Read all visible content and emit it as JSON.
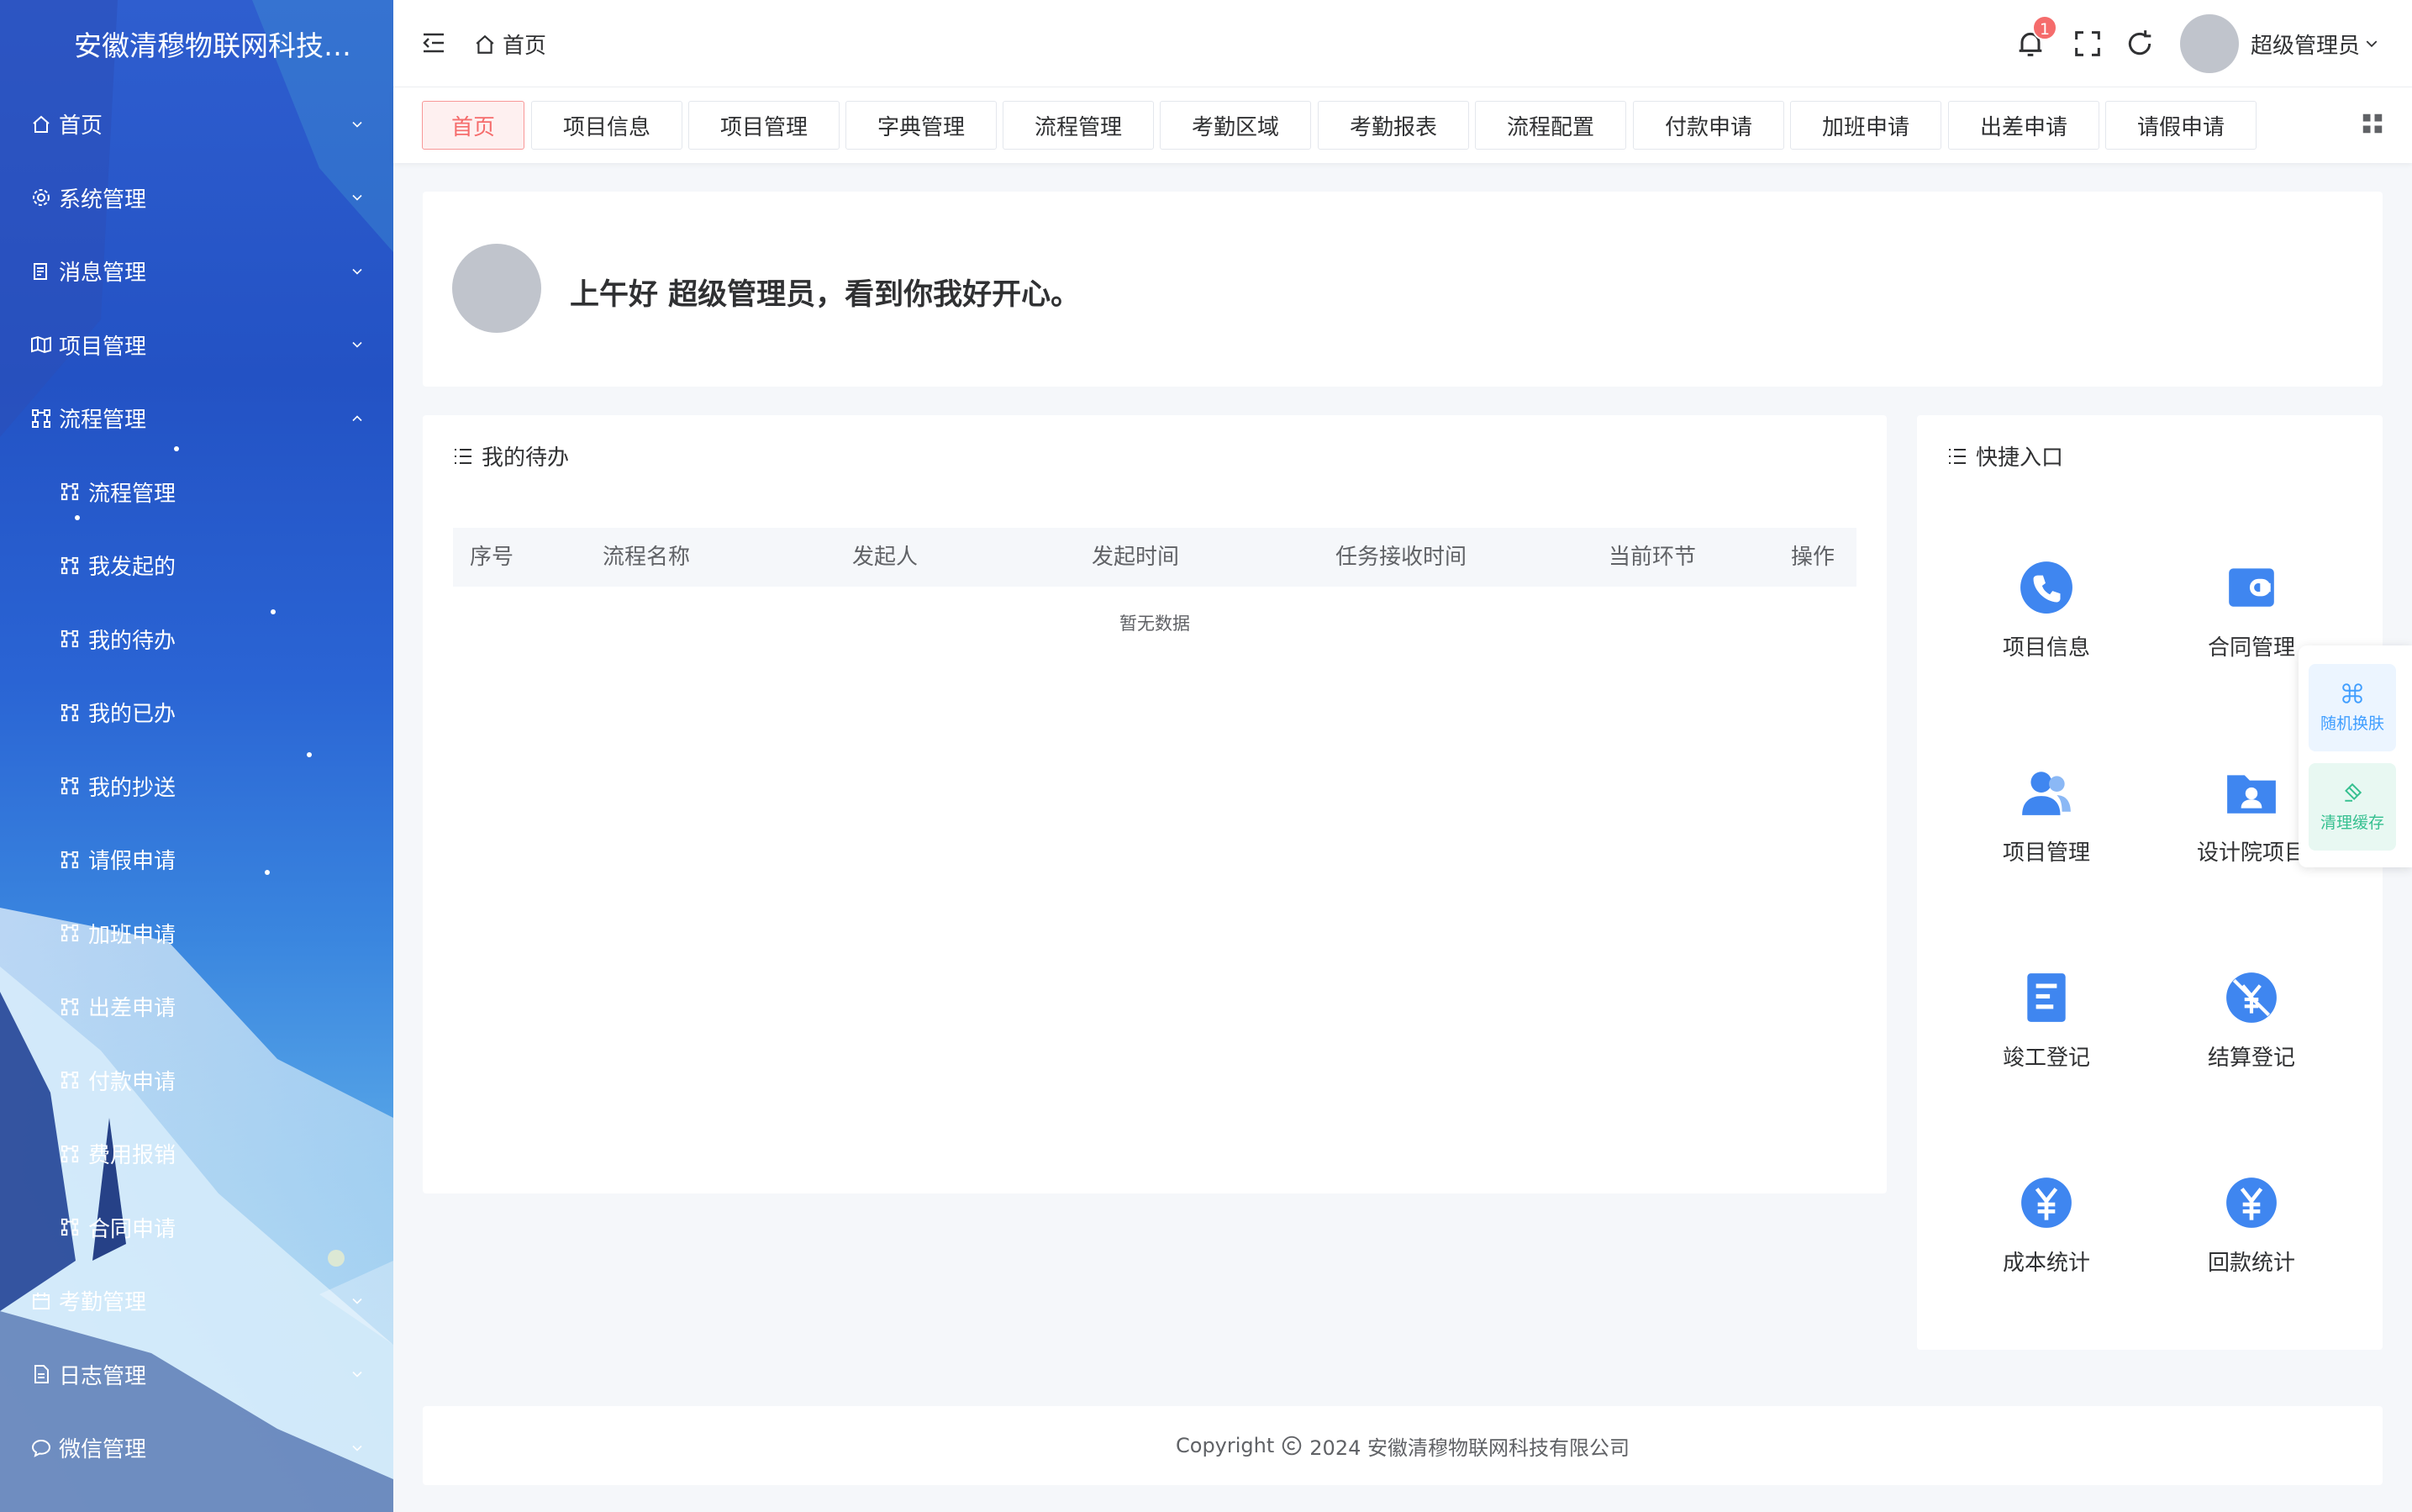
{
  "app": {
    "title": "安徽清穆物联网科技有..."
  },
  "sidebar": {
    "items": [
      {
        "label": "首页",
        "icon": "home-icon"
      },
      {
        "label": "系统管理",
        "icon": "gear-icon"
      },
      {
        "label": "消息管理",
        "icon": "document-icon"
      },
      {
        "label": "项目管理",
        "icon": "map-icon"
      },
      {
        "label": "流程管理",
        "icon": "flow-icon",
        "expanded": true
      },
      {
        "label": "流程管理",
        "icon": "flow-icon",
        "sub": true
      },
      {
        "label": "我发起的",
        "icon": "flow-icon",
        "sub": true
      },
      {
        "label": "我的待办",
        "icon": "flow-icon",
        "sub": true
      },
      {
        "label": "我的已办",
        "icon": "flow-icon",
        "sub": true
      },
      {
        "label": "我的抄送",
        "icon": "flow-icon",
        "sub": true
      },
      {
        "label": "请假申请",
        "icon": "flow-icon",
        "sub": true
      },
      {
        "label": "加班申请",
        "icon": "flow-icon",
        "sub": true
      },
      {
        "label": "出差申请",
        "icon": "flow-icon",
        "sub": true
      },
      {
        "label": "付款申请",
        "icon": "flow-icon",
        "sub": true
      },
      {
        "label": "费用报销",
        "icon": "flow-icon",
        "sub": true
      },
      {
        "label": "合同申请",
        "icon": "flow-icon",
        "sub": true
      },
      {
        "label": "考勤管理",
        "icon": "calendar-icon"
      },
      {
        "label": "日志管理",
        "icon": "log-icon"
      },
      {
        "label": "微信管理",
        "icon": "chat-icon"
      }
    ]
  },
  "header": {
    "breadcrumb": "首页",
    "notification_count": "1",
    "user_name": "超级管理员"
  },
  "tabs": [
    "首页",
    "项目信息",
    "项目管理",
    "字典管理",
    "流程管理",
    "考勤区域",
    "考勤报表",
    "流程配置",
    "付款申请",
    "加班申请",
    "出差申请",
    "请假申请"
  ],
  "welcome": {
    "text": "上午好 超级管理员，看到你我好开心。"
  },
  "todo": {
    "title": "我的待办",
    "columns": [
      "序号",
      "流程名称",
      "发起人",
      "发起时间",
      "任务接收时间",
      "当前环节",
      "操作"
    ],
    "empty_text": "暂无数据"
  },
  "quick": {
    "title": "快捷入口",
    "items": [
      {
        "label": "项目信息",
        "icon": "phone-icon"
      },
      {
        "label": "合同管理",
        "icon": "wallet-icon"
      },
      {
        "label": "项目管理",
        "icon": "users-icon"
      },
      {
        "label": "设计院项目",
        "icon": "folder-user-icon"
      },
      {
        "label": "竣工登记",
        "icon": "document-list-icon"
      },
      {
        "label": "结算登记",
        "icon": "no-yen-icon"
      },
      {
        "label": "成本统计",
        "icon": "yen-icon"
      },
      {
        "label": "回款统计",
        "icon": "yen-icon"
      }
    ]
  },
  "footer": {
    "copyright": "Copyright",
    "year_company": "2024 安徽清穆物联网科技有限公司"
  },
  "tools": {
    "skin": "随机换肤",
    "cache": "清理缓存"
  },
  "colors": {
    "accent": "#409eff",
    "active_tab": "#f56c6c",
    "icon_blue": "#3f86f0"
  }
}
